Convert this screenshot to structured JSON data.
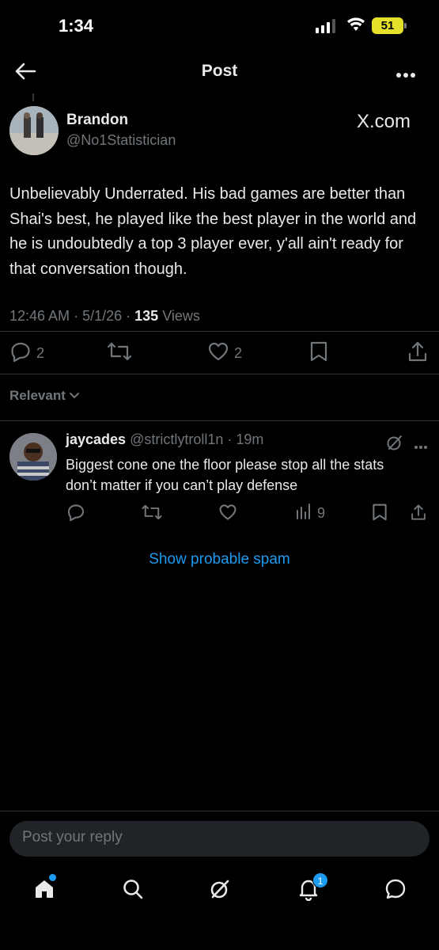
{
  "status_bar": {
    "time": "1:34",
    "battery": "51"
  },
  "header": {
    "title": "Post"
  },
  "post": {
    "author_name": "Brandon",
    "author_handle": "@No1Statistician",
    "source_link": "X.com",
    "text": "Unbelievably Underrated. His bad games are better than Shai's best, he played like the best player in the world and he is undoubtedly a top 3 player ever, y'all ain't ready for that conversation though.",
    "time": "12:46 AM",
    "date": "5/1/26",
    "views_count": "135",
    "views_label": "Views",
    "reply_count": "2",
    "like_count": "2"
  },
  "sort": {
    "label": "Relevant"
  },
  "replies": [
    {
      "name": "jaycades",
      "handle": "@strictlytroll1n",
      "time": "19m",
      "text": "Biggest cone one the floor please stop all the stats don’t matter if you can’t play defense",
      "views_count": "9"
    }
  ],
  "spam_link": "Show probable spam",
  "composer": {
    "placeholder": "Post your reply"
  },
  "tabbar": {
    "notifications_badge": "1"
  },
  "colors": {
    "accent": "#1d9bf0",
    "muted": "#71767b",
    "background": "#000000",
    "battery": "#e5e02a"
  }
}
